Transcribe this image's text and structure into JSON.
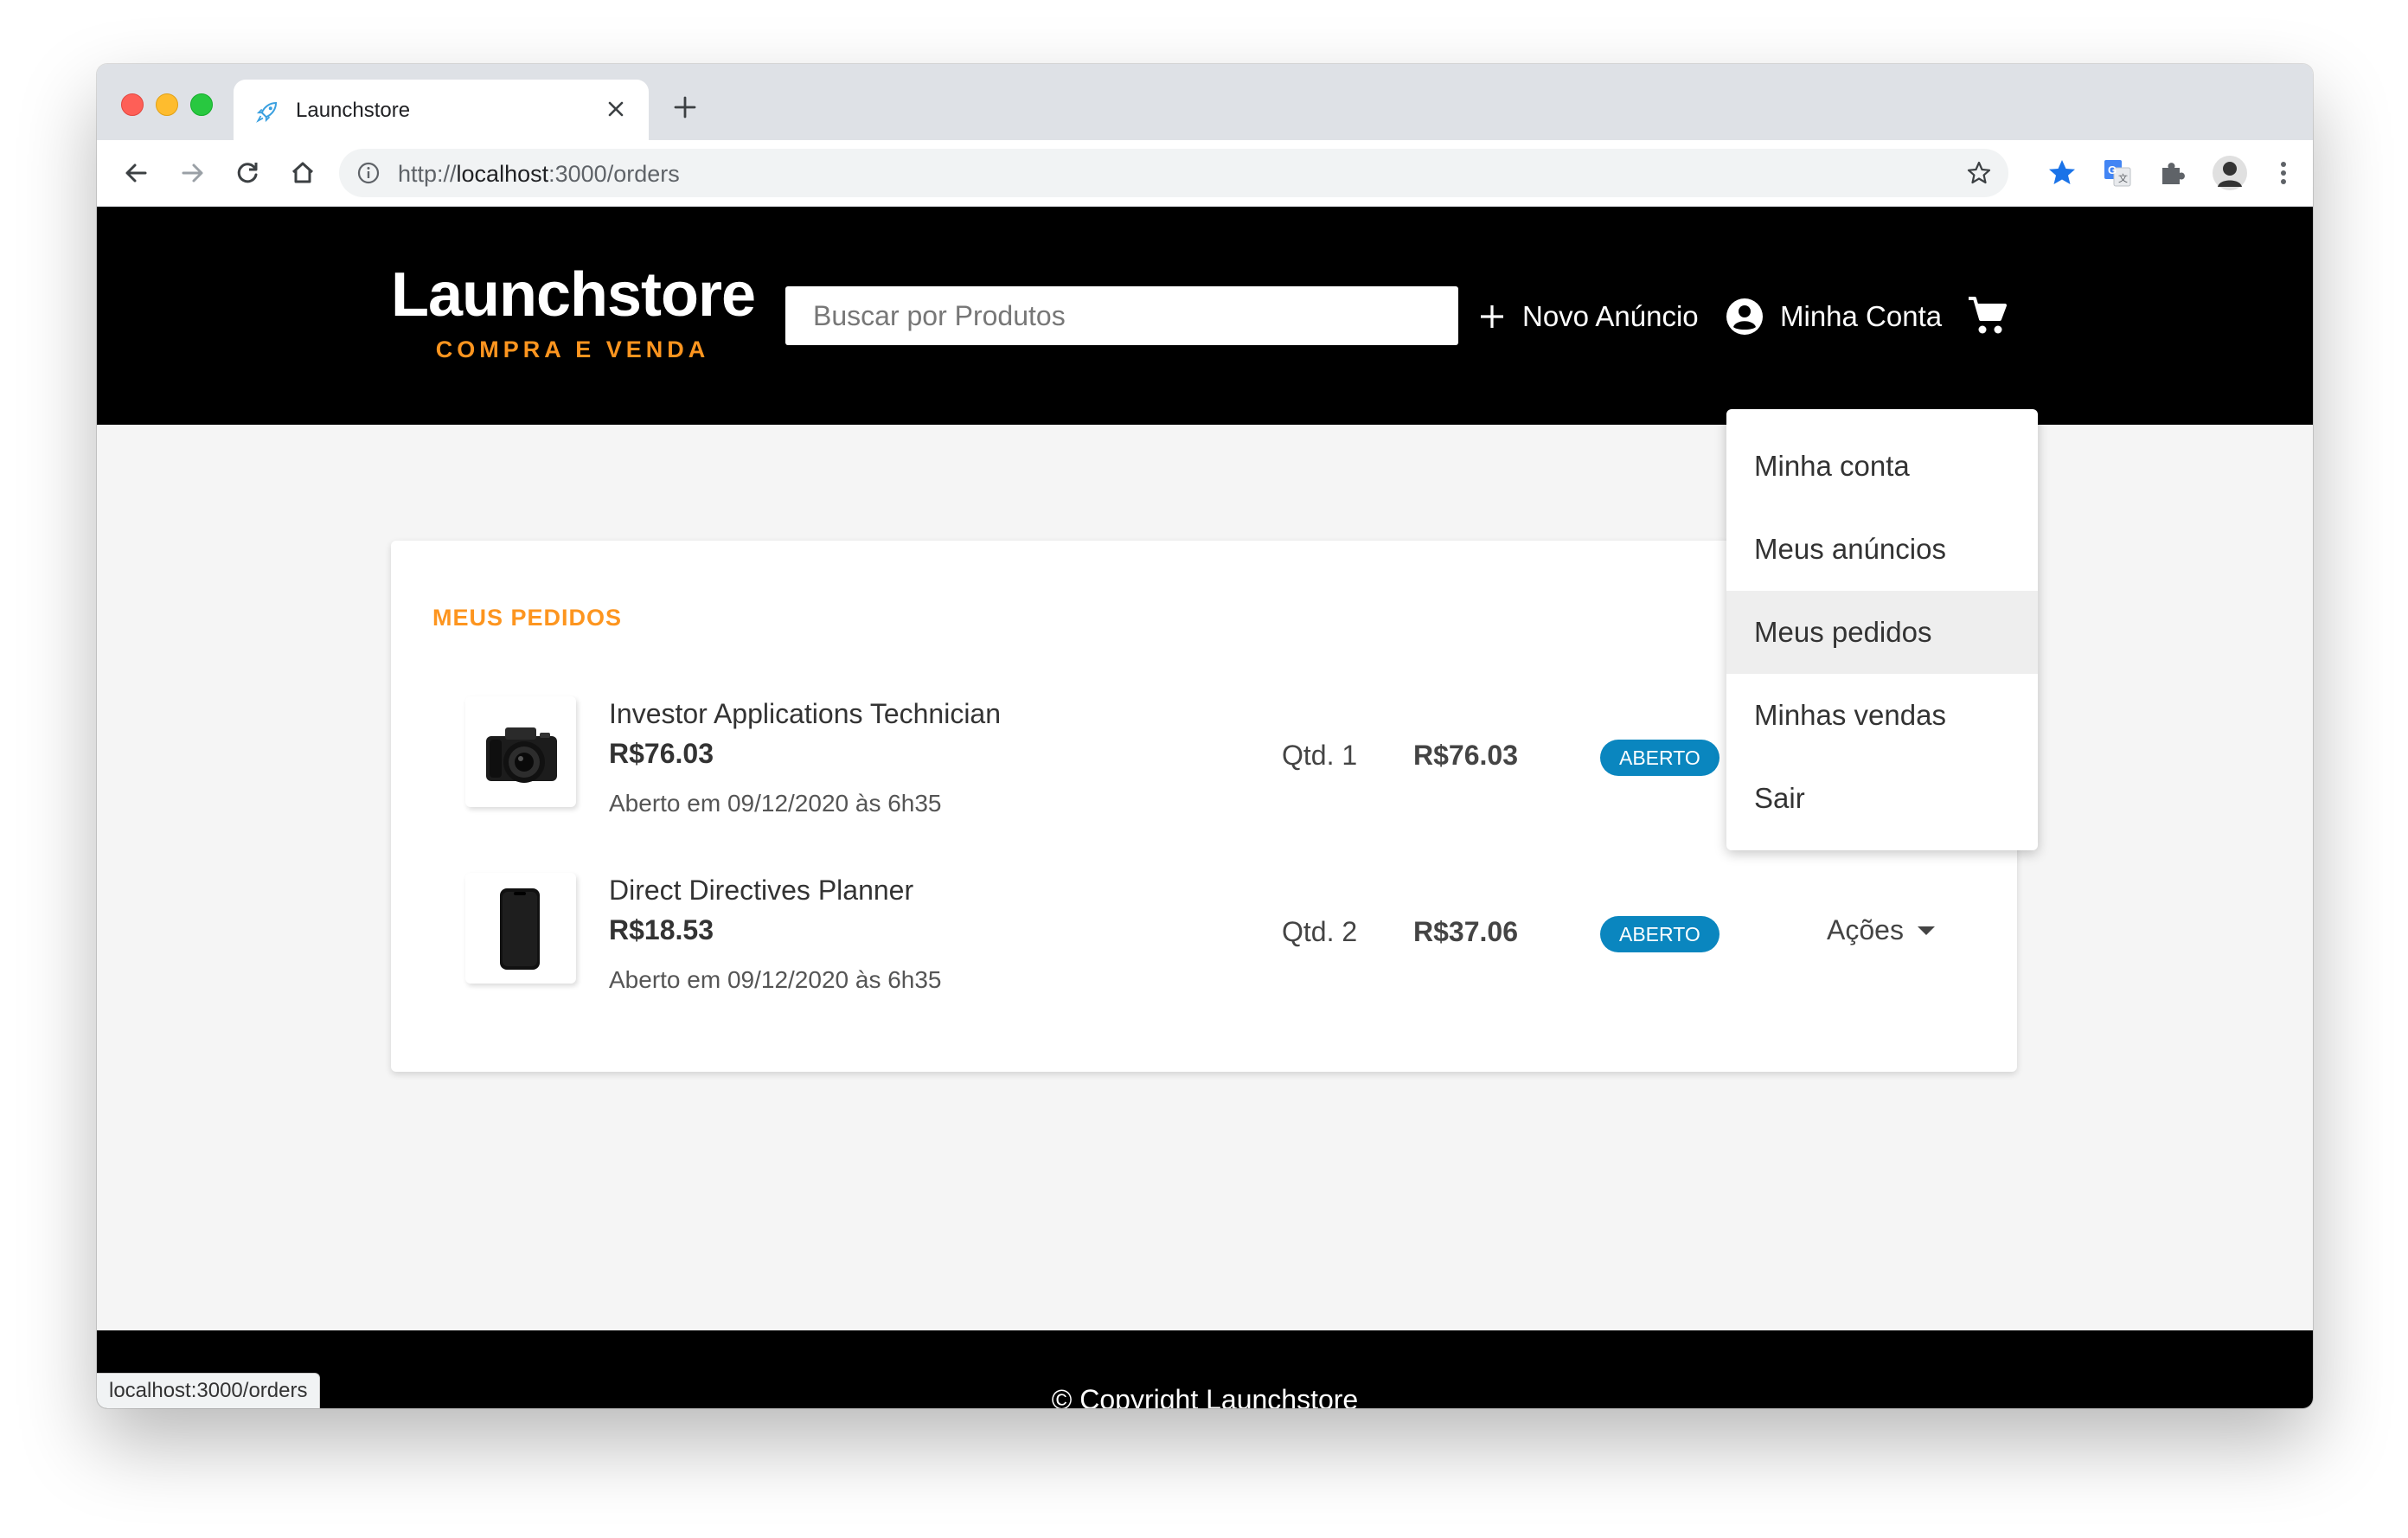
{
  "browser": {
    "tab_title": "Launchstore",
    "url_scheme": "http://",
    "url_host": "localhost",
    "url_path": ":3000/orders",
    "status_url": "localhost:3000/orders"
  },
  "header": {
    "logo_title": "Launchstore",
    "logo_subtitle": "COMPRA E VENDA",
    "search_placeholder": "Buscar por Produtos",
    "new_listing": "Novo Anúncio",
    "account": "Minha Conta",
    "accent_color": "#fd951f"
  },
  "account_menu": {
    "items": [
      {
        "label": "Minha conta"
      },
      {
        "label": "Meus anúncios"
      },
      {
        "label": "Meus pedidos",
        "active": true
      },
      {
        "label": "Minhas vendas"
      },
      {
        "label": "Sair"
      }
    ]
  },
  "orders": {
    "title": "MEUS PEDIDOS",
    "actions_label": "Ações",
    "items": [
      {
        "product": "Investor Applications Technician",
        "price": "R$76.03",
        "date": "Aberto em 09/12/2020 às 6h35",
        "qty": "Qtd. 1",
        "total": "R$76.03",
        "status": "ABERTO",
        "image": "camera-icon"
      },
      {
        "product": "Direct Directives Planner",
        "price": "R$18.53",
        "date": "Aberto em 09/12/2020 às 6h35",
        "qty": "Qtd. 2",
        "total": "R$37.06",
        "status": "ABERTO",
        "image": "smartphone-icon"
      }
    ]
  },
  "footer": {
    "copyright": "© Copyright Launchstore"
  }
}
